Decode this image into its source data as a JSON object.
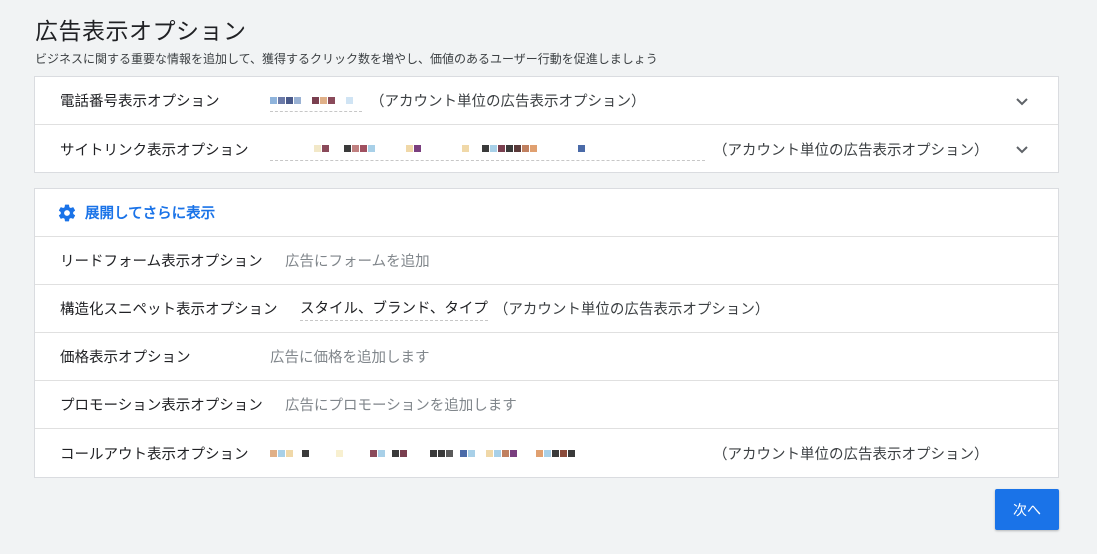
{
  "header": {
    "title": "広告表示オプション",
    "subtitle": "ビジネスに関する重要な情報を追加して、獲得するクリック数を増やし、価値のあるユーザー行動を促進しましょう"
  },
  "extensions_primary": [
    {
      "label": "電話番号表示オプション",
      "scope": "（アカウント単位の広告表示オプション）"
    },
    {
      "label": "サイトリンク表示オプション",
      "scope": "（アカウント単位の広告表示オプション）"
    }
  ],
  "expand": {
    "label": "展開してさらに表示"
  },
  "extensions_more": {
    "lead_form": {
      "label": "リードフォーム表示オプション",
      "placeholder": "広告にフォームを追加"
    },
    "structured_snippet": {
      "label": "構造化スニペット表示オプション",
      "value": "スタイル、ブランド、タイプ",
      "scope": "（アカウント単位の広告表示オプション）"
    },
    "price": {
      "label": "価格表示オプション",
      "placeholder": "広告に価格を追加します"
    },
    "promotion": {
      "label": "プロモーション表示オプション",
      "placeholder": "広告にプロモーションを追加します"
    },
    "callout": {
      "label": "コールアウト表示オプション",
      "scope": "（アカウント単位の広告表示オプション）"
    }
  },
  "footer": {
    "next_label": "次へ"
  },
  "colors": {
    "accent": "#1a73e8",
    "border": "#dadce0",
    "background": "#f1f3f4"
  },
  "icons": {
    "expand": "gear-icon",
    "row_toggle": "chevron-down-icon"
  }
}
